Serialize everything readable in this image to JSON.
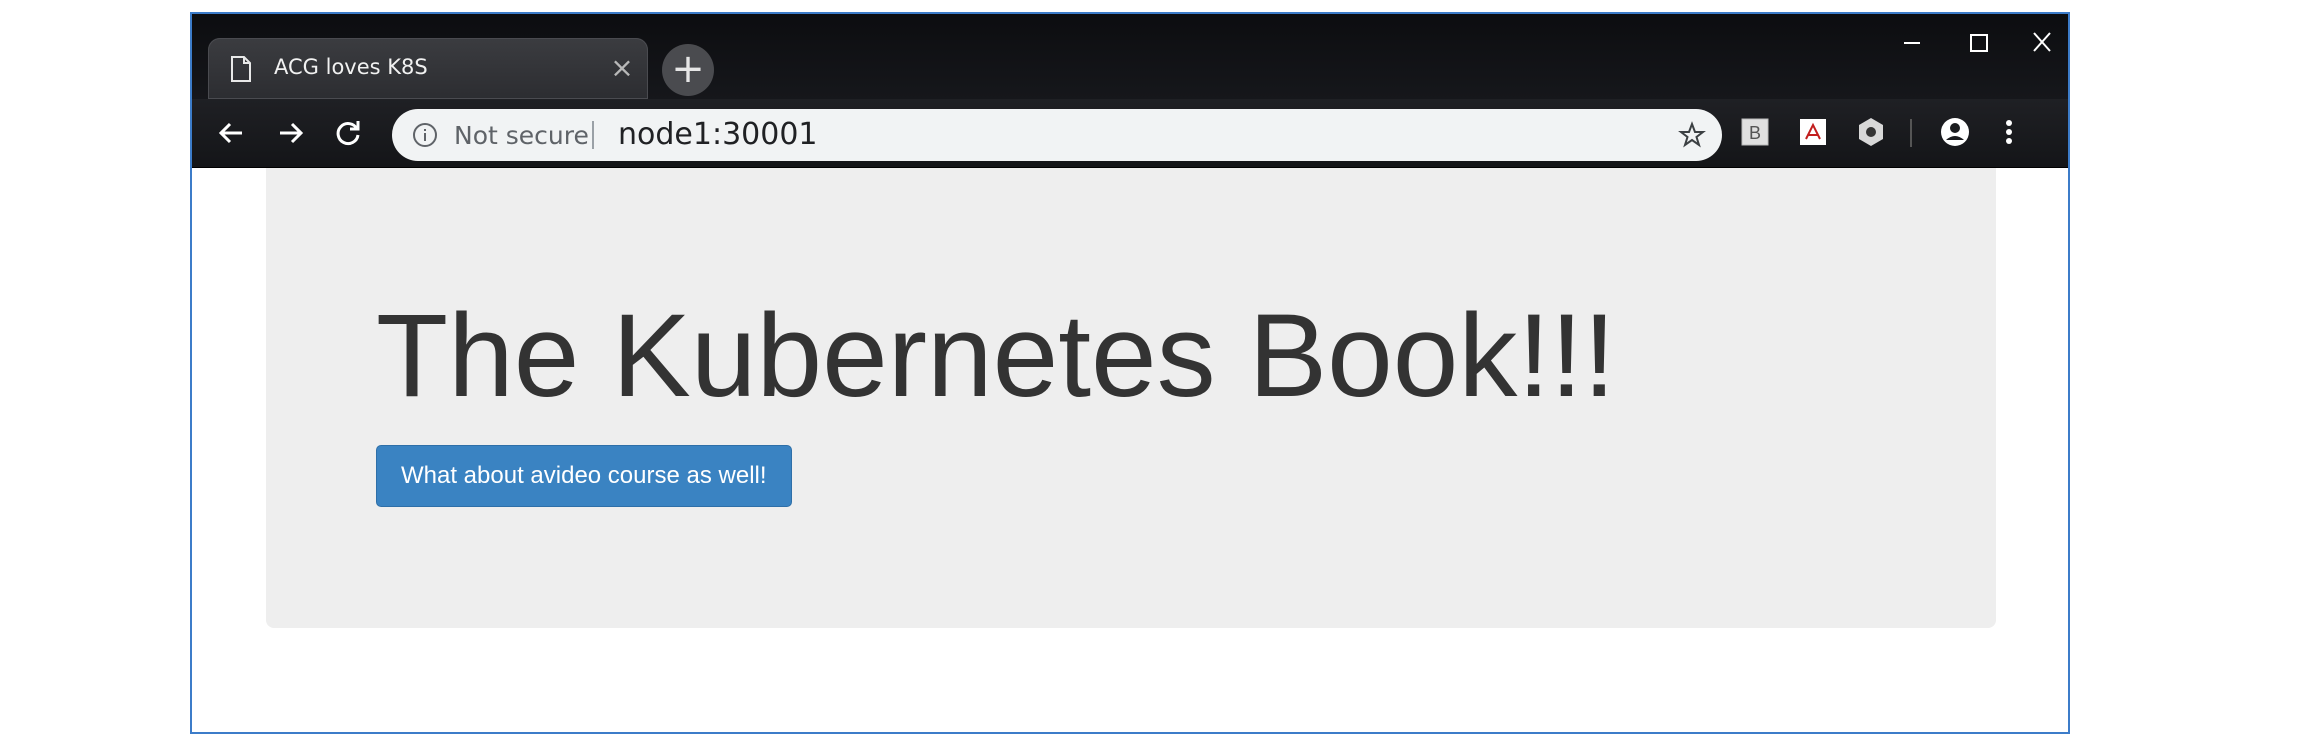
{
  "browser": {
    "tab": {
      "title": "ACG loves K8S",
      "close_glyph": "×"
    },
    "new_tab_glyph": "+",
    "address_bar": {
      "security_label": "Not secure",
      "url": "node1:30001"
    },
    "window_controls": [
      "minimize-icon",
      "maximize-icon",
      "close-icon"
    ],
    "nav_icons": [
      "back-arrow-icon",
      "forward-arrow-icon",
      "reload-icon"
    ],
    "extension_icons": [
      "bootstrap-extension-icon",
      "pdf-extension-icon",
      "settings-extension-icon"
    ],
    "profile_icon": "account-circle-icon",
    "menu_icon": "vertical-dots-icon"
  },
  "page": {
    "heading": "The Kubernetes Book!!!",
    "button_label": "What about avideo course as well!"
  },
  "colors": {
    "window_border": "#3c7cc9",
    "jumbotron_bg": "#eeeeee",
    "button_bg": "#3a83c2",
    "heading_text": "#333333"
  }
}
